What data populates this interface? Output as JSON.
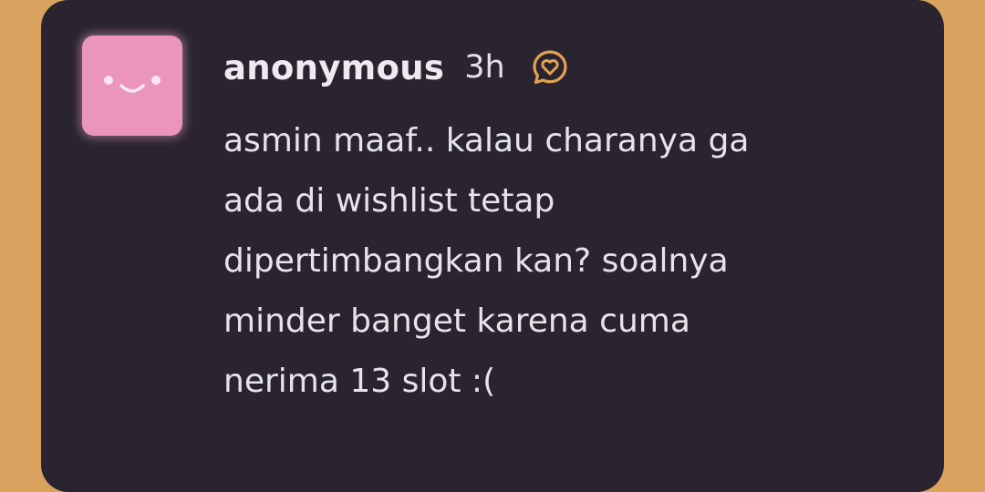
{
  "post": {
    "username": "anonymous",
    "time": "3h",
    "message": "asmin maaf.. kalau charanya ga\nada di wishlist tetap\ndipertimbangkan kan? soalnya\nminder banget karena cuma\nnerima 13 slot :("
  },
  "icons": {
    "avatar": "smiley-face-icon",
    "reply": "heart-speech-bubble-icon"
  },
  "colors": {
    "background": "#D9A35F",
    "card": "#29242F",
    "avatar": "#EA94BE",
    "text": "#E6E3EA",
    "icon_accent": "#E3A152"
  }
}
